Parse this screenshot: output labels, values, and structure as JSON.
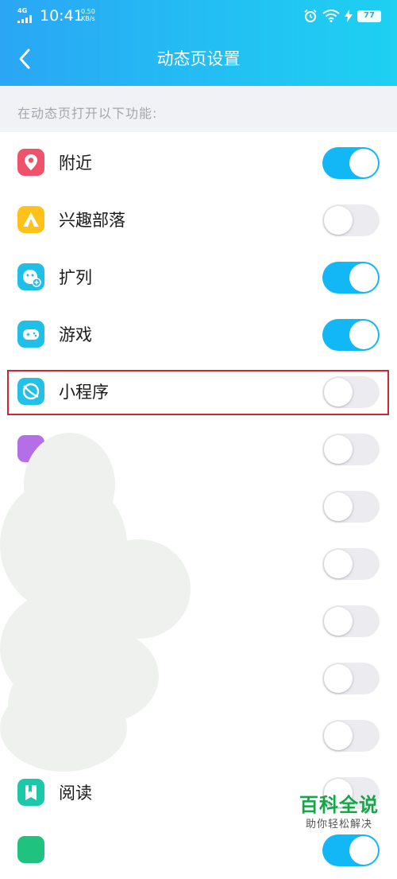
{
  "status_bar": {
    "network": "4G",
    "time": "10:41",
    "speed_value": "0.50",
    "speed_unit": "KB/s",
    "battery": "77"
  },
  "nav": {
    "back_icon": "chevron-left-icon",
    "title": "动态页设置"
  },
  "section": {
    "label": "在动态页打开以下功能:"
  },
  "items": [
    {
      "label": "附近",
      "icon": "location-pin-icon",
      "icon_color": "#f0526b",
      "enabled": true
    },
    {
      "label": "兴趣部落",
      "icon": "tent-icon",
      "icon_color": "#ffc21a",
      "enabled": false
    },
    {
      "label": "扩列",
      "icon": "add-friend-face-icon",
      "icon_color": "#1ec0e8",
      "enabled": true
    },
    {
      "label": "游戏",
      "icon": "gamepad-icon",
      "icon_color": "#1ec0e8",
      "enabled": true
    },
    {
      "label": "小程序",
      "icon": "planet-icon",
      "icon_color": "#23c0e8",
      "enabled": false
    },
    {
      "label": "",
      "enabled": false
    },
    {
      "label": "",
      "enabled": false
    },
    {
      "label": "",
      "enabled": false
    },
    {
      "label": "",
      "enabled": false
    },
    {
      "label": "",
      "enabled": false
    },
    {
      "label": "",
      "enabled": false
    },
    {
      "label": "阅读",
      "icon": "book-icon",
      "icon_color": "#1cc8a8",
      "enabled": false
    }
  ],
  "watermark": {
    "title": "百科全说",
    "subtitle": "助你轻松解决"
  },
  "colors": {
    "header_start": "#2aa6f4",
    "header_end": "#1ed0f2",
    "switch_on": "#12b7f5",
    "switch_off": "#ececf0",
    "highlight": "#d32431"
  }
}
